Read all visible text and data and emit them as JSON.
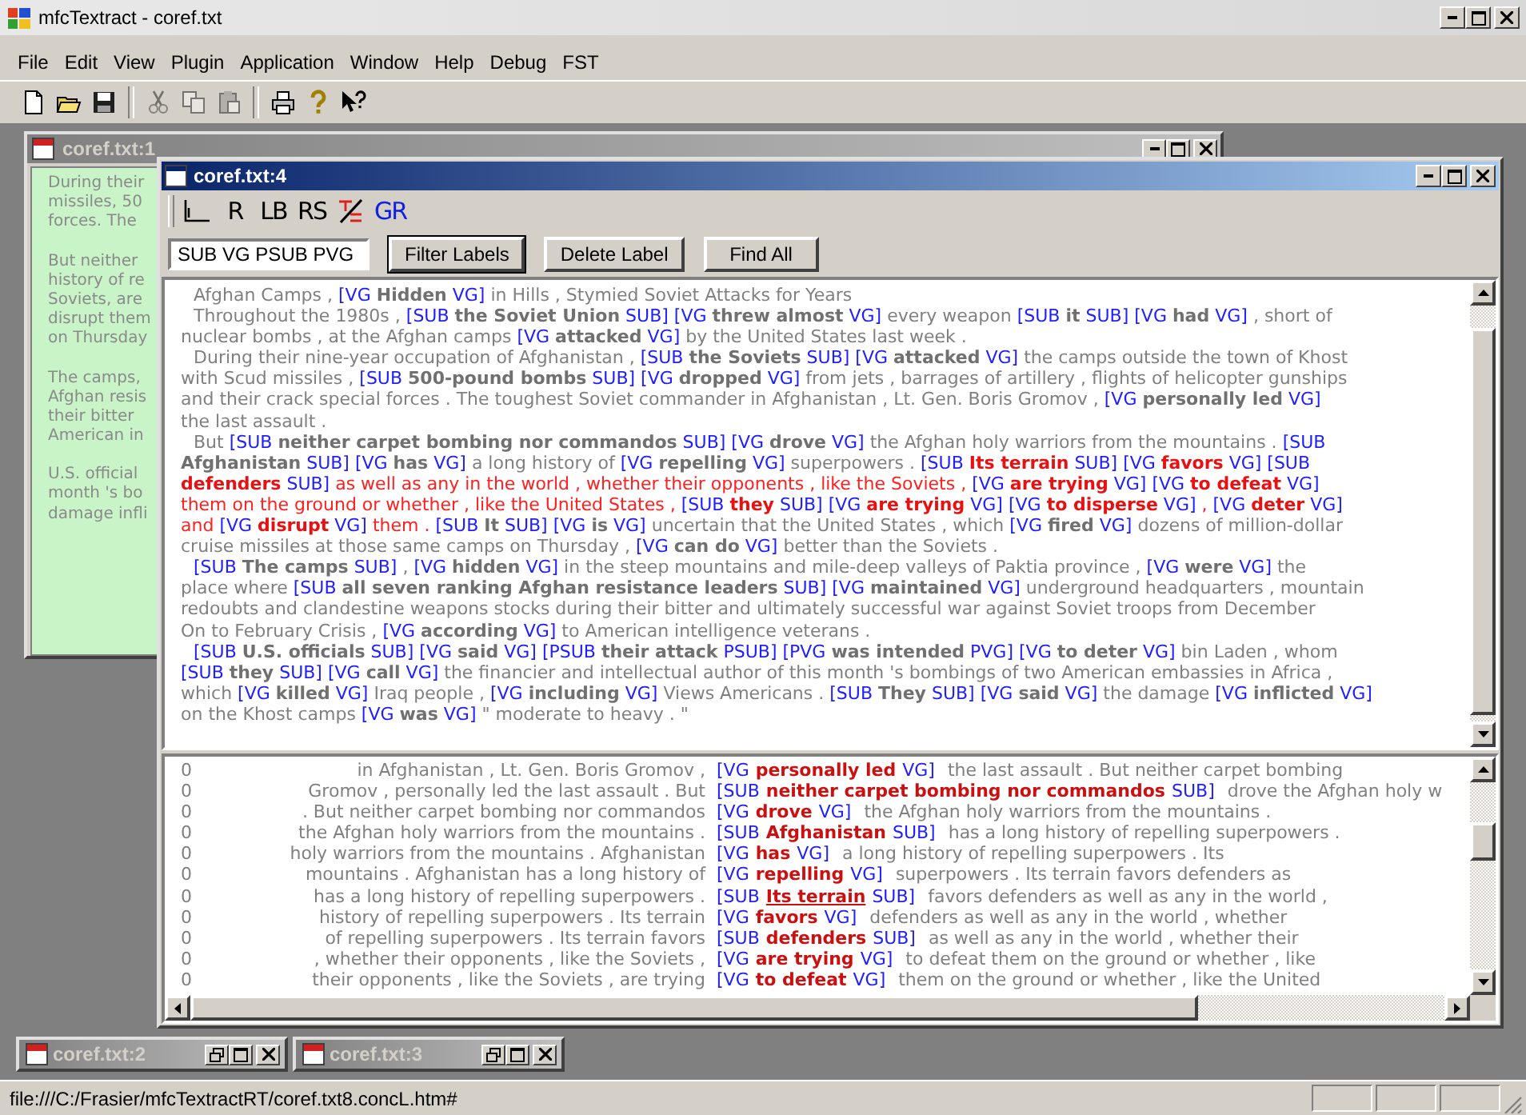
{
  "app": {
    "title": "mfcTextract - coref.txt"
  },
  "menu": [
    {
      "label": "File"
    },
    {
      "label": "Edit"
    },
    {
      "label": "View"
    },
    {
      "label": "Plugin"
    },
    {
      "label": "Application"
    },
    {
      "label": "Window"
    },
    {
      "label": "Help"
    },
    {
      "label": "Debug"
    },
    {
      "label": "FST"
    }
  ],
  "toolbar": [
    {
      "kind": "new",
      "disabled": false
    },
    {
      "kind": "open",
      "disabled": false
    },
    {
      "kind": "save",
      "disabled": false
    },
    {
      "kind": "separator"
    },
    {
      "kind": "cut",
      "disabled": true
    },
    {
      "kind": "copy",
      "disabled": true
    },
    {
      "kind": "paste",
      "disabled": true
    },
    {
      "kind": "separator"
    },
    {
      "kind": "print",
      "disabled": false
    },
    {
      "kind": "help",
      "disabled": false
    },
    {
      "kind": "context-help",
      "disabled": false
    }
  ],
  "back_window": {
    "title": "coref.txt:1",
    "active": false,
    "paragraphs": [
      [
        "During their",
        "missiles, 50",
        "forces. The"
      ],
      [
        "But neither",
        "history of re",
        "Soviets, are",
        "disrupt them",
        "on Thursday"
      ],
      [
        "The camps,",
        "Afghan resis",
        "their bitter",
        "American in"
      ],
      [
        "U.S. official",
        "month 's bo",
        "damage infli"
      ]
    ]
  },
  "doc_window": {
    "title": "coref.txt:4",
    "active": true,
    "tools": [
      {
        "kind": "corner"
      },
      {
        "kind": "glyph",
        "label": "R"
      },
      {
        "kind": "glyph",
        "label": "LB"
      },
      {
        "kind": "glyph",
        "label": "RS"
      },
      {
        "kind": "tree-doc"
      },
      {
        "kind": "accent-glyph",
        "label": "GR"
      }
    ],
    "filter": {
      "value": "SUB VG PSUB PVG"
    },
    "buttons": [
      {
        "label": "Filter Labels",
        "default": true
      },
      {
        "label": "Delete Label",
        "default": false
      },
      {
        "label": "Find All",
        "default": false
      }
    ],
    "text_lines": [
      {
        "indent": true,
        "segments": [
          {
            "kind": "text",
            "text": "Afghan Camps , "
          },
          {
            "kind": "tag",
            "text": "[VG "
          },
          {
            "kind": "head",
            "text": "Hidden"
          },
          {
            "kind": "tag",
            "text": " VG]"
          },
          {
            "kind": "text",
            "text": " in Hills , Stymied Soviet Attacks for Years"
          }
        ]
      },
      {
        "indent": true,
        "segments": [
          {
            "kind": "text",
            "text": "Throughout the 1980s , "
          },
          {
            "kind": "tag",
            "text": "[SUB "
          },
          {
            "kind": "head",
            "text": "the Soviet Union"
          },
          {
            "kind": "tag",
            "text": " SUB] [VG "
          },
          {
            "kind": "head",
            "text": "threw almost"
          },
          {
            "kind": "tag",
            "text": " VG]"
          },
          {
            "kind": "text",
            "text": " every weapon "
          },
          {
            "kind": "tag",
            "text": "[SUB "
          },
          {
            "kind": "head",
            "text": "it"
          },
          {
            "kind": "tag",
            "text": " SUB] [VG "
          },
          {
            "kind": "head",
            "text": "had"
          },
          {
            "kind": "tag",
            "text": " VG]"
          },
          {
            "kind": "text",
            "text": " , short of"
          }
        ]
      },
      {
        "indent": false,
        "segments": [
          {
            "kind": "text",
            "text": "nuclear bombs , at the Afghan camps "
          },
          {
            "kind": "tag",
            "text": "[VG "
          },
          {
            "kind": "head",
            "text": "attacked"
          },
          {
            "kind": "tag",
            "text": " VG]"
          },
          {
            "kind": "text",
            "text": " by the United States last week ."
          }
        ]
      },
      {
        "indent": true,
        "segments": [
          {
            "kind": "text",
            "text": "During their nine-year occupation of Afghanistan , "
          },
          {
            "kind": "tag",
            "text": "[SUB "
          },
          {
            "kind": "head",
            "text": "the Soviets"
          },
          {
            "kind": "tag",
            "text": " SUB] [VG "
          },
          {
            "kind": "head",
            "text": "attacked"
          },
          {
            "kind": "tag",
            "text": " VG]"
          },
          {
            "kind": "text",
            "text": " the camps outside the town of Khost"
          }
        ]
      },
      {
        "indent": false,
        "segments": [
          {
            "kind": "text",
            "text": "with Scud missiles , "
          },
          {
            "kind": "tag",
            "text": "[SUB "
          },
          {
            "kind": "head",
            "text": "500-pound bombs"
          },
          {
            "kind": "tag",
            "text": " SUB] [VG "
          },
          {
            "kind": "head",
            "text": "dropped"
          },
          {
            "kind": "tag",
            "text": " VG]"
          },
          {
            "kind": "text",
            "text": " from jets , barrages of artillery , flights of helicopter gunships"
          }
        ]
      },
      {
        "indent": false,
        "segments": [
          {
            "kind": "text",
            "text": "and their crack special forces . The toughest Soviet commander in Afghanistan , Lt. Gen. Boris Gromov , "
          },
          {
            "kind": "tag",
            "text": "[VG "
          },
          {
            "kind": "head",
            "text": "personally led"
          },
          {
            "kind": "tag",
            "text": " VG]"
          }
        ]
      },
      {
        "indent": false,
        "segments": [
          {
            "kind": "text",
            "text": "the last assault ."
          }
        ]
      },
      {
        "indent": true,
        "segments": [
          {
            "kind": "text",
            "text": "But "
          },
          {
            "kind": "tag",
            "text": "[SUB "
          },
          {
            "kind": "head",
            "text": "neither carpet bombing nor commandos"
          },
          {
            "kind": "tag",
            "text": " SUB] [VG "
          },
          {
            "kind": "head",
            "text": "drove"
          },
          {
            "kind": "tag",
            "text": " VG]"
          },
          {
            "kind": "text",
            "text": " the Afghan holy warriors from the mountains . "
          },
          {
            "kind": "tag",
            "text": "[SUB"
          }
        ]
      },
      {
        "indent": false,
        "segments": [
          {
            "kind": "head",
            "text": "Afghanistan"
          },
          {
            "kind": "tag",
            "text": " SUB] [VG "
          },
          {
            "kind": "head",
            "text": "has"
          },
          {
            "kind": "tag",
            "text": " VG]"
          },
          {
            "kind": "text",
            "text": " a long history of "
          },
          {
            "kind": "tag",
            "text": "[VG "
          },
          {
            "kind": "head",
            "text": "repelling"
          },
          {
            "kind": "tag",
            "text": " VG]"
          },
          {
            "kind": "text",
            "text": " superpowers . "
          },
          {
            "kind": "tag",
            "text": "[SUB "
          },
          {
            "kind": "hl-head",
            "text": "Its terrain"
          },
          {
            "kind": "tag",
            "text": " SUB] [VG "
          },
          {
            "kind": "hl-head",
            "text": "favors"
          },
          {
            "kind": "tag",
            "text": " VG] [SUB"
          }
        ]
      },
      {
        "indent": false,
        "segments": [
          {
            "kind": "hl-head",
            "text": "defenders"
          },
          {
            "kind": "tag",
            "text": " SUB]"
          },
          {
            "kind": "hl",
            "text": " as well as any in the world , whether their opponents , like the Soviets , "
          },
          {
            "kind": "tag",
            "text": "[VG "
          },
          {
            "kind": "hl-head",
            "text": "are trying"
          },
          {
            "kind": "tag",
            "text": " VG] [VG "
          },
          {
            "kind": "hl-head",
            "text": "to defeat"
          },
          {
            "kind": "tag",
            "text": " VG]"
          }
        ]
      },
      {
        "indent": false,
        "segments": [
          {
            "kind": "hl",
            "text": "them on the ground or whether , like the United States , "
          },
          {
            "kind": "tag",
            "text": "[SUB "
          },
          {
            "kind": "hl-head",
            "text": "they"
          },
          {
            "kind": "tag",
            "text": " SUB] [VG "
          },
          {
            "kind": "hl-head",
            "text": "are trying"
          },
          {
            "kind": "tag",
            "text": " VG] [VG "
          },
          {
            "kind": "hl-head",
            "text": "to disperse"
          },
          {
            "kind": "tag",
            "text": " VG]"
          },
          {
            "kind": "hl",
            "text": " , "
          },
          {
            "kind": "tag",
            "text": "[VG "
          },
          {
            "kind": "hl-head",
            "text": "deter"
          },
          {
            "kind": "tag",
            "text": " VG]"
          }
        ]
      },
      {
        "indent": false,
        "segments": [
          {
            "kind": "hl",
            "text": "and "
          },
          {
            "kind": "tag",
            "text": "[VG "
          },
          {
            "kind": "hl-head",
            "text": "disrupt"
          },
          {
            "kind": "tag",
            "text": " VG]"
          },
          {
            "kind": "hl",
            "text": " them . "
          },
          {
            "kind": "tag",
            "text": "[SUB "
          },
          {
            "kind": "head",
            "text": "It"
          },
          {
            "kind": "tag",
            "text": " SUB] [VG "
          },
          {
            "kind": "head",
            "text": "is"
          },
          {
            "kind": "tag",
            "text": " VG]"
          },
          {
            "kind": "text",
            "text": " uncertain that the United States , which "
          },
          {
            "kind": "tag",
            "text": "[VG "
          },
          {
            "kind": "head",
            "text": "fired"
          },
          {
            "kind": "tag",
            "text": " VG]"
          },
          {
            "kind": "text",
            "text": " dozens of million-dollar"
          }
        ]
      },
      {
        "indent": false,
        "segments": [
          {
            "kind": "text",
            "text": "cruise missiles at those same camps on Thursday , "
          },
          {
            "kind": "tag",
            "text": "[VG "
          },
          {
            "kind": "head",
            "text": "can do"
          },
          {
            "kind": "tag",
            "text": " VG]"
          },
          {
            "kind": "text",
            "text": " better than the Soviets ."
          }
        ]
      },
      {
        "indent": true,
        "segments": [
          {
            "kind": "tag",
            "text": "[SUB "
          },
          {
            "kind": "head",
            "text": "The camps"
          },
          {
            "kind": "tag",
            "text": " SUB]"
          },
          {
            "kind": "text",
            "text": " , "
          },
          {
            "kind": "tag",
            "text": "[VG "
          },
          {
            "kind": "head",
            "text": "hidden"
          },
          {
            "kind": "tag",
            "text": " VG]"
          },
          {
            "kind": "text",
            "text": " in the steep mountains and mile-deep valleys of Paktia province , "
          },
          {
            "kind": "tag",
            "text": "[VG "
          },
          {
            "kind": "head",
            "text": "were"
          },
          {
            "kind": "tag",
            "text": " VG]"
          },
          {
            "kind": "text",
            "text": " the"
          }
        ]
      },
      {
        "indent": false,
        "segments": [
          {
            "kind": "text",
            "text": "place where "
          },
          {
            "kind": "tag",
            "text": "[SUB "
          },
          {
            "kind": "head",
            "text": "all seven ranking Afghan resistance leaders"
          },
          {
            "kind": "tag",
            "text": " SUB] [VG "
          },
          {
            "kind": "head",
            "text": "maintained"
          },
          {
            "kind": "tag",
            "text": " VG]"
          },
          {
            "kind": "text",
            "text": " underground headquarters , mountain"
          }
        ]
      },
      {
        "indent": false,
        "segments": [
          {
            "kind": "text",
            "text": "redoubts and clandestine weapons stocks during their bitter and ultimately successful war against Soviet troops from December"
          }
        ]
      },
      {
        "indent": false,
        "segments": [
          {
            "kind": "text",
            "text": "On to February Crisis , "
          },
          {
            "kind": "tag",
            "text": "[VG "
          },
          {
            "kind": "head",
            "text": "according"
          },
          {
            "kind": "tag",
            "text": " VG]"
          },
          {
            "kind": "text",
            "text": " to American intelligence veterans ."
          }
        ]
      },
      {
        "indent": true,
        "segments": [
          {
            "kind": "tag",
            "text": "[SUB "
          },
          {
            "kind": "head",
            "text": "U.S. officials"
          },
          {
            "kind": "tag",
            "text": " SUB] [VG "
          },
          {
            "kind": "head",
            "text": "said"
          },
          {
            "kind": "tag",
            "text": " VG] [PSUB "
          },
          {
            "kind": "head",
            "text": "their attack"
          },
          {
            "kind": "tag",
            "text": " PSUB] [PVG "
          },
          {
            "kind": "head",
            "text": "was intended"
          },
          {
            "kind": "tag",
            "text": " PVG] [VG "
          },
          {
            "kind": "head",
            "text": "to deter"
          },
          {
            "kind": "tag",
            "text": " VG]"
          },
          {
            "kind": "text",
            "text": " bin Laden , whom"
          }
        ]
      },
      {
        "indent": false,
        "segments": [
          {
            "kind": "tag",
            "text": "[SUB "
          },
          {
            "kind": "head",
            "text": "they"
          },
          {
            "kind": "tag",
            "text": " SUB] [VG "
          },
          {
            "kind": "head",
            "text": "call"
          },
          {
            "kind": "tag",
            "text": " VG]"
          },
          {
            "kind": "text",
            "text": " the financier and intellectual author of this month 's bombings of two American embassies in Africa ,"
          }
        ]
      },
      {
        "indent": false,
        "segments": [
          {
            "kind": "text",
            "text": "which "
          },
          {
            "kind": "tag",
            "text": "[VG "
          },
          {
            "kind": "head",
            "text": "killed"
          },
          {
            "kind": "tag",
            "text": " VG]"
          },
          {
            "kind": "text",
            "text": " Iraq people , "
          },
          {
            "kind": "tag",
            "text": "[VG "
          },
          {
            "kind": "head",
            "text": "including"
          },
          {
            "kind": "tag",
            "text": " VG]"
          },
          {
            "kind": "text",
            "text": " Views Americans . "
          },
          {
            "kind": "tag",
            "text": "[SUB "
          },
          {
            "kind": "head",
            "text": "They"
          },
          {
            "kind": "tag",
            "text": " SUB] [VG "
          },
          {
            "kind": "head",
            "text": "said"
          },
          {
            "kind": "tag",
            "text": " VG]"
          },
          {
            "kind": "text",
            "text": " the damage "
          },
          {
            "kind": "tag",
            "text": "[VG "
          },
          {
            "kind": "head",
            "text": "inflicted"
          },
          {
            "kind": "tag",
            "text": " VG]"
          }
        ]
      },
      {
        "indent": false,
        "segments": [
          {
            "kind": "text",
            "text": "on the Khost camps "
          },
          {
            "kind": "tag",
            "text": "[VG "
          },
          {
            "kind": "head",
            "text": "was"
          },
          {
            "kind": "tag",
            "text": " VG]"
          },
          {
            "kind": "text",
            "text": " \" moderate to heavy . \""
          }
        ]
      }
    ],
    "concordance": [
      {
        "count": "0",
        "left": "in Afghanistan , Lt. Gen. Boris Gromov ,",
        "open": "[VG",
        "key": "personally led",
        "close": "VG]",
        "right": "the last assault . But neither carpet bombing",
        "linked": false
      },
      {
        "count": "0",
        "left": "Gromov , personally led the last assault . But",
        "open": "[SUB",
        "key": "neither carpet bombing nor commandos",
        "close": "SUB]",
        "right": "drove the Afghan holy w",
        "linked": false
      },
      {
        "count": "0",
        "left": ". But neither carpet bombing nor commandos",
        "open": "[VG",
        "key": "drove",
        "close": "VG]",
        "right": "the Afghan holy warriors from the mountains .",
        "linked": false
      },
      {
        "count": "0",
        "left": "the Afghan holy warriors from the mountains .",
        "open": "[SUB",
        "key": "Afghanistan",
        "close": "SUB]",
        "right": "has a long history of repelling superpowers .",
        "linked": false
      },
      {
        "count": "0",
        "left": "holy warriors from the mountains . Afghanistan",
        "open": "[VG",
        "key": "has",
        "close": "VG]",
        "right": "a long history of repelling superpowers . Its",
        "linked": false
      },
      {
        "count": "0",
        "left": "mountains . Afghanistan has a long history of",
        "open": "[VG",
        "key": "repelling",
        "close": "VG]",
        "right": "superpowers . Its terrain favors defenders as",
        "linked": false
      },
      {
        "count": "0",
        "left": "has a long history of repelling superpowers .",
        "open": "[SUB",
        "key": "Its terrain",
        "close": "SUB]",
        "right": "favors defenders as well as any in the world ,",
        "linked": true
      },
      {
        "count": "0",
        "left": "history of repelling superpowers . Its terrain",
        "open": "[VG",
        "key": "favors",
        "close": "VG]",
        "right": "defenders as well as any in the world , whether",
        "linked": false
      },
      {
        "count": "0",
        "left": "of repelling superpowers . Its terrain favors",
        "open": "[SUB",
        "key": "defenders",
        "close": "SUB]",
        "right": "as well as any in the world , whether their",
        "linked": false
      },
      {
        "count": "0",
        "left": ", whether their opponents , like the Soviets ,",
        "open": "[VG",
        "key": "are trying",
        "close": "VG]",
        "right": "to defeat them on the ground or whether , like",
        "linked": false
      },
      {
        "count": "0",
        "left": "their opponents , like the Soviets , are trying",
        "open": "[VG",
        "key": "to defeat",
        "close": "VG]",
        "right": "them on the ground or whether , like the United",
        "linked": false
      }
    ]
  },
  "minimized": [
    {
      "title": "coref.txt:2"
    },
    {
      "title": "coref.txt:3"
    }
  ],
  "status_bar": {
    "text": "file:///C:/Frasier/mfcTextractRT/coref.txt8.concL.htm#"
  }
}
